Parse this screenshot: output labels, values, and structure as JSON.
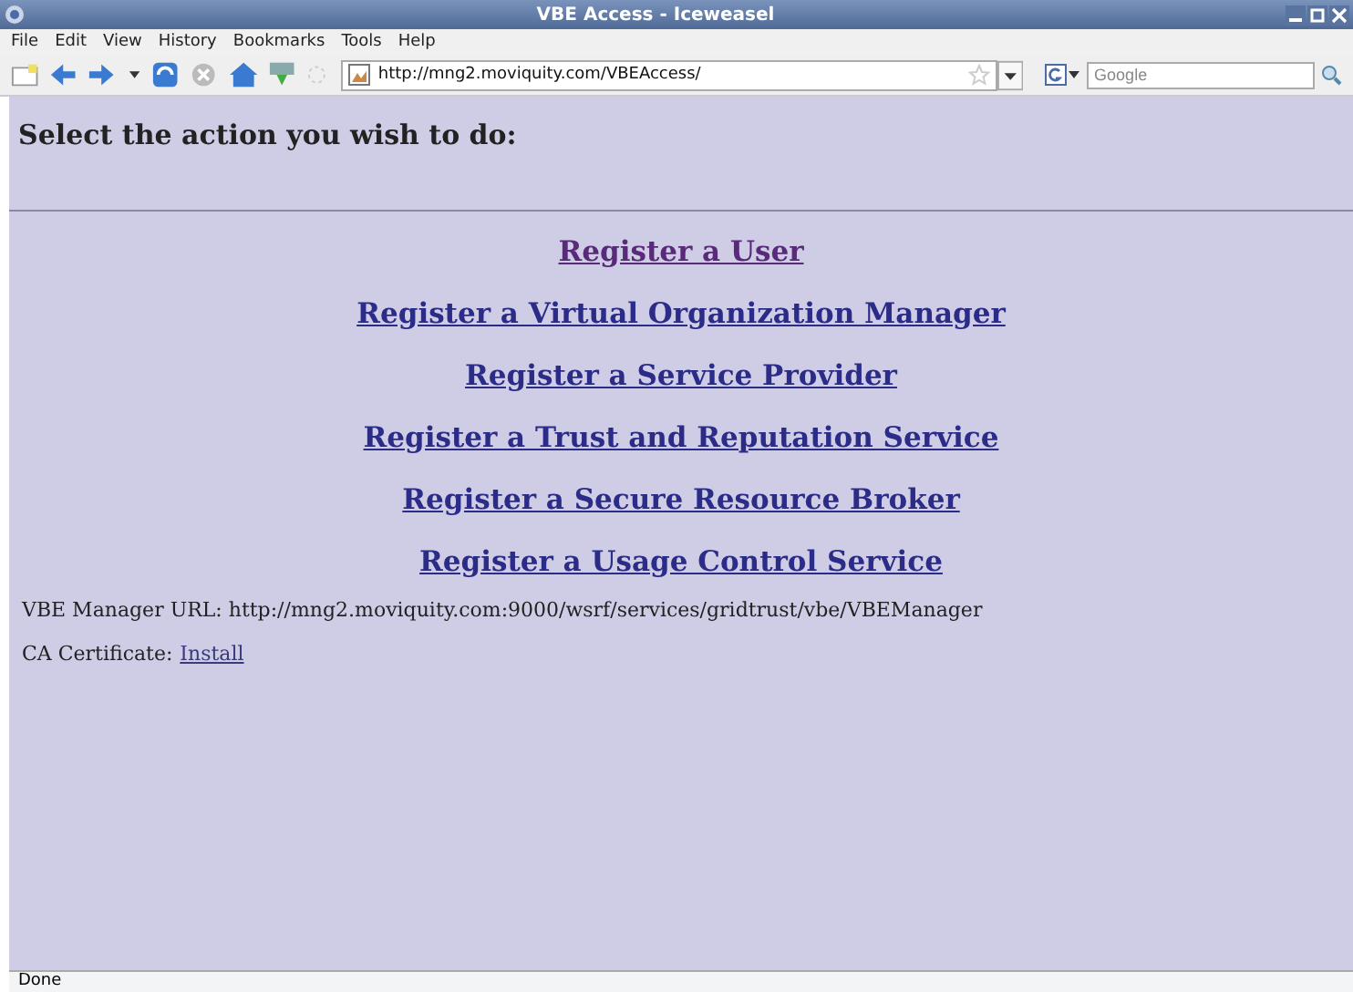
{
  "window": {
    "title": "VBE Access - Iceweasel"
  },
  "menu": [
    "File",
    "Edit",
    "View",
    "History",
    "Bookmarks",
    "Tools",
    "Help"
  ],
  "address_bar": {
    "value": "http://mng2.moviquity.com/VBEAccess/"
  },
  "search": {
    "placeholder": "Google"
  },
  "page": {
    "heading": "Select the action you wish to do:",
    "links": [
      {
        "label": "Register a User",
        "visited": true
      },
      {
        "label": "Register a Virtual Organization Manager",
        "visited": false
      },
      {
        "label": "Register a Service Provider",
        "visited": false
      },
      {
        "label": "Register a Trust and Reputation Service",
        "visited": false
      },
      {
        "label": "Register a Secure Resource Broker",
        "visited": false
      },
      {
        "label": "Register a Usage Control Service",
        "visited": false
      }
    ],
    "manager_url": "VBE Manager URL: http://mng2.moviquity.com:9000/wsrf/services/gridtrust/vbe/VBEManager",
    "certificate_label": "CA Certificate:",
    "certificate_link": "Install"
  },
  "status_bar": "Done"
}
